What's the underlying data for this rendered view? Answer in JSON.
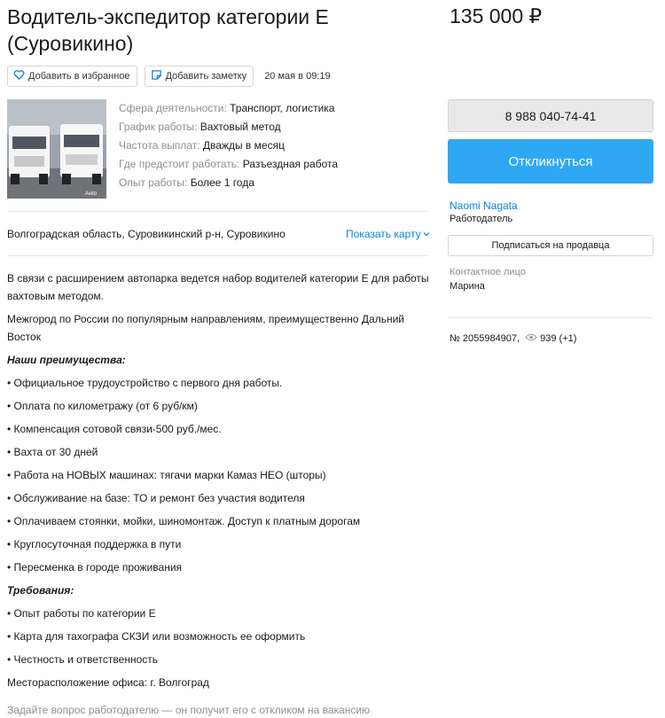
{
  "listing": {
    "title": "Водитель-экспедитор категории Е (Суровикино)",
    "price": "135 000 ₽",
    "favorite_label": "Добавить в избранное",
    "note_label": "Добавить заметку",
    "date": "20 мая в 09:19"
  },
  "params": [
    {
      "label": "Сфера деятельности:",
      "value": "Транспорт, логистика"
    },
    {
      "label": "График работы:",
      "value": "Вахтовый метод"
    },
    {
      "label": "Частота выплат:",
      "value": "Дважды в месяц"
    },
    {
      "label": "Где предстоит работать:",
      "value": "Разъездная работа"
    },
    {
      "label": "Опыт работы:",
      "value": "Более 1 года"
    }
  ],
  "location": {
    "address": "Волгоградская область, Суровикинский р-н, Суровикино",
    "show_map": "Показать карту"
  },
  "description": {
    "intro": "В связи с расширением автопарка ведется набор водителей категории Е для работы вахтовым методом.",
    "routes": "Межгород по России по популярным направлениям, преимущественно Дальний Восток",
    "advantages_title": "Наши преимущества:",
    "advantages": [
      "• Официальное трудоустройство с первого дня работы.",
      "• Оплата по километражу (от 6 руб/км)",
      "• Компенсация сотовой связи-500 руб./мес.",
      "• Вахта от 30 дней",
      "• Работа на НОВЫХ машинах: тягачи марки Камаз НЕО (шторы)",
      "• Обслуживание на базе: ТО и ремонт без участия водителя",
      "• Оплачиваем стоянки, мойки, шиномонтаж. Доступ к платным дорогам",
      "• Круглосуточная поддержка в пути",
      "• Пересменка в городе проживания"
    ],
    "requirements_title": "Требования:",
    "requirements": [
      "• Опыт работы по категории Е",
      "• Карта для тахографа СКЗИ или возможность ее оформить",
      "• Честность и ответственность"
    ],
    "office": "Месторасположение офиса: г. Волгоград",
    "ask": "Задайте вопрос работодателю — он получит его с откликом на вакансию"
  },
  "sidebar": {
    "phone": "8 988 040-74-41",
    "respond_label": "Откликнуться",
    "seller_name": "Naomi Nagata",
    "seller_role": "Работодатель",
    "subscribe_label": "Подписаться на продавца",
    "contact_label": "Контактное лицо",
    "contact_name": "Марина",
    "listing_id": "№ 2055984907,",
    "views": "939 (+1)"
  },
  "photo_watermark": "Avito",
  "colors": {
    "accent": "#2ea8f2",
    "link": "#0a85d6"
  }
}
